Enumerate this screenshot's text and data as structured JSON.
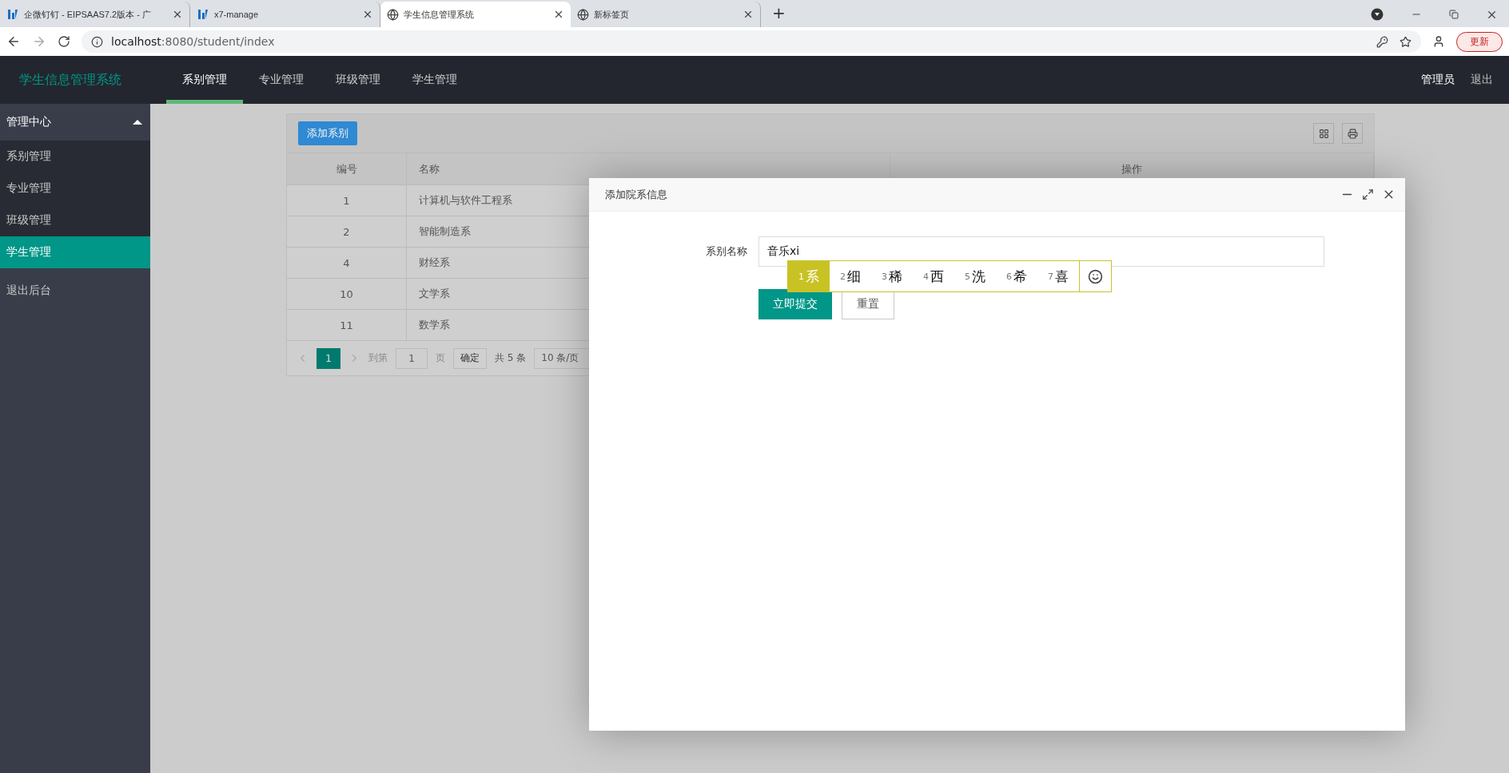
{
  "browser": {
    "tabs": [
      {
        "title": "企微钉钉 - EIPSAAS7.2版本 - 广",
        "kind": "app",
        "selected": false
      },
      {
        "title": "x7-manage",
        "kind": "app",
        "selected": false
      },
      {
        "title": "学生信息管理系统",
        "kind": "web",
        "selected": true
      },
      {
        "title": "新标签页",
        "kind": "web",
        "selected": false
      }
    ],
    "new_tab": "+",
    "url_host": "localhost",
    "url_rest": ":8080/student/index",
    "update_button": "更新"
  },
  "app": {
    "logo": "学生信息管理系统",
    "nav": [
      {
        "label": "系别管理",
        "selected": true
      },
      {
        "label": "专业管理",
        "selected": false
      },
      {
        "label": "班级管理",
        "selected": false
      },
      {
        "label": "学生管理",
        "selected": false
      }
    ],
    "user": "管理员",
    "logout": "退出"
  },
  "sidebar": {
    "header": "管理中心",
    "expanded": true,
    "items": [
      {
        "label": "系别管理",
        "selected": false
      },
      {
        "label": "专业管理",
        "selected": false
      },
      {
        "label": "班级管理",
        "selected": false
      },
      {
        "label": "学生管理",
        "selected": true
      },
      {
        "label": "退出后台",
        "selected": false
      }
    ]
  },
  "table": {
    "add_button": "添加系别",
    "columns": [
      "编号",
      "名称",
      "操作"
    ],
    "rows": [
      [
        "1",
        "计算机与软件工程系"
      ],
      [
        "2",
        "智能制造系"
      ],
      [
        "4",
        "财经系"
      ],
      [
        "10",
        "文学系"
      ],
      [
        "11",
        "数学系"
      ]
    ],
    "pagination": {
      "page": "1",
      "goto_label": "到第",
      "goto_value": "1",
      "page_unit": "页",
      "confirm": "确定",
      "total": "共 5 条",
      "page_size": "10 条/页"
    }
  },
  "dialog": {
    "title": "添加院系信息",
    "field_label": "系别名称",
    "field_value": "音乐xi",
    "submit": "立即提交",
    "reset": "重置"
  },
  "ime": {
    "candidates": [
      {
        "index": "1",
        "text": "系",
        "selected": true
      },
      {
        "index": "2",
        "text": "细",
        "selected": false
      },
      {
        "index": "3",
        "text": "稀",
        "selected": false
      },
      {
        "index": "4",
        "text": "西",
        "selected": false
      },
      {
        "index": "5",
        "text": "洗",
        "selected": false
      },
      {
        "index": "6",
        "text": "希",
        "selected": false
      },
      {
        "index": "7",
        "text": "喜",
        "selected": false
      }
    ]
  }
}
